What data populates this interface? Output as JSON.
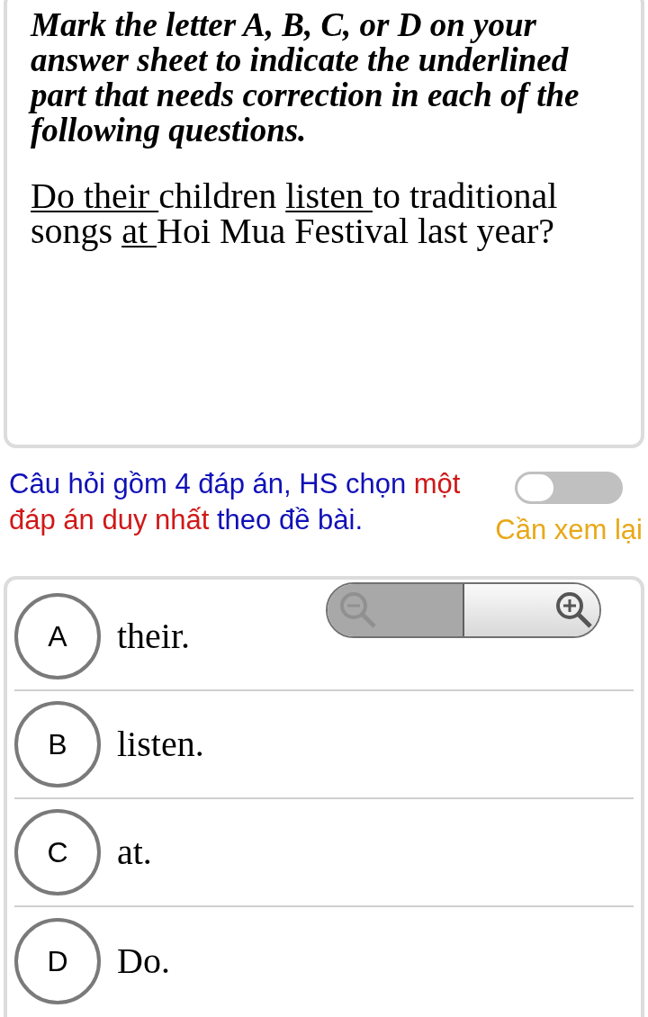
{
  "instruction": "Mark the letter A, B, C, or D on your answer sheet to indicate the underlined part that needs correction in each of the following questions.",
  "question": [
    {
      "kind": "underlined",
      "text": "Do their "
    },
    {
      "kind": "plain",
      "text": "children "
    },
    {
      "kind": "underlined",
      "text": "listen "
    },
    {
      "kind": "plain",
      "text": "to traditional songs "
    },
    {
      "kind": "underlined",
      "text": "at "
    },
    {
      "kind": "plain",
      "text": "Hoi Mua Festival last year?"
    }
  ],
  "hint": [
    {
      "text": "Câu hỏi gồm 4 đáp án, HS chọn ",
      "emphasis": false
    },
    {
      "text": "một đáp án duy nhất",
      "emphasis": true
    },
    {
      "text": " theo đề bài.",
      "emphasis": false
    }
  ],
  "review_toggle": {
    "on": false,
    "label": "Cần xem lại"
  },
  "zoom_control": {
    "zoom_out_disabled": true
  },
  "options": [
    {
      "letter": "A",
      "text": "their.",
      "selected": false
    },
    {
      "letter": "B",
      "text": "listen.",
      "selected": false
    },
    {
      "letter": "C",
      "text": "at.",
      "selected": false
    },
    {
      "letter": "D",
      "text": "Do.",
      "selected": false
    }
  ]
}
